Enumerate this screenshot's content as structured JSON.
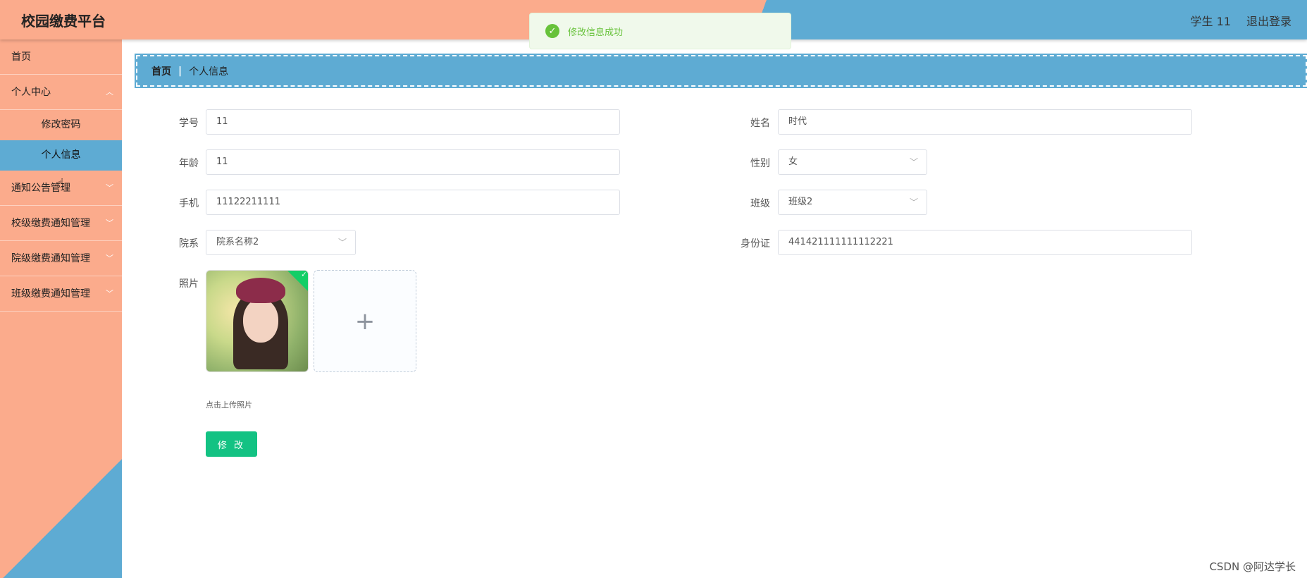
{
  "header": {
    "title": "校园缴费平台",
    "user": "学生 11",
    "logout": "退出登录"
  },
  "toast": {
    "message": "修改信息成功",
    "icon": "check-circle-icon",
    "color": "#67c23a"
  },
  "sidebar": {
    "items": [
      {
        "label": "首页"
      },
      {
        "label": "个人中心",
        "expanded": true,
        "children": [
          {
            "label": "修改密码"
          },
          {
            "label": "个人信息",
            "active": true
          }
        ]
      },
      {
        "label": "通知公告管理"
      },
      {
        "label": "校级缴费通知管理"
      },
      {
        "label": "院级缴费通知管理"
      },
      {
        "label": "班级缴费通知管理"
      }
    ]
  },
  "breadcrumb": {
    "home": "首页",
    "separator": "|",
    "current": "个人信息"
  },
  "form": {
    "student_id": {
      "label": "学号",
      "value": "11"
    },
    "name": {
      "label": "姓名",
      "value": "时代"
    },
    "age": {
      "label": "年龄",
      "value": "11"
    },
    "gender": {
      "label": "性别",
      "value": "女"
    },
    "phone": {
      "label": "手机",
      "value": "11122211111"
    },
    "class": {
      "label": "班级",
      "value": "班级2"
    },
    "department": {
      "label": "院系",
      "value": "院系名称2"
    },
    "id_card": {
      "label": "身份证",
      "value": "441421111111112221"
    },
    "photo": {
      "label": "照片",
      "hint": "点击上传照片",
      "upload_icon": "+"
    },
    "submit_label": "修 改"
  },
  "watermark": "CSDN @阿达学长",
  "colors": {
    "header_left": "#fbab8c",
    "header_right": "#5eabd3",
    "accent": "#13c283"
  }
}
